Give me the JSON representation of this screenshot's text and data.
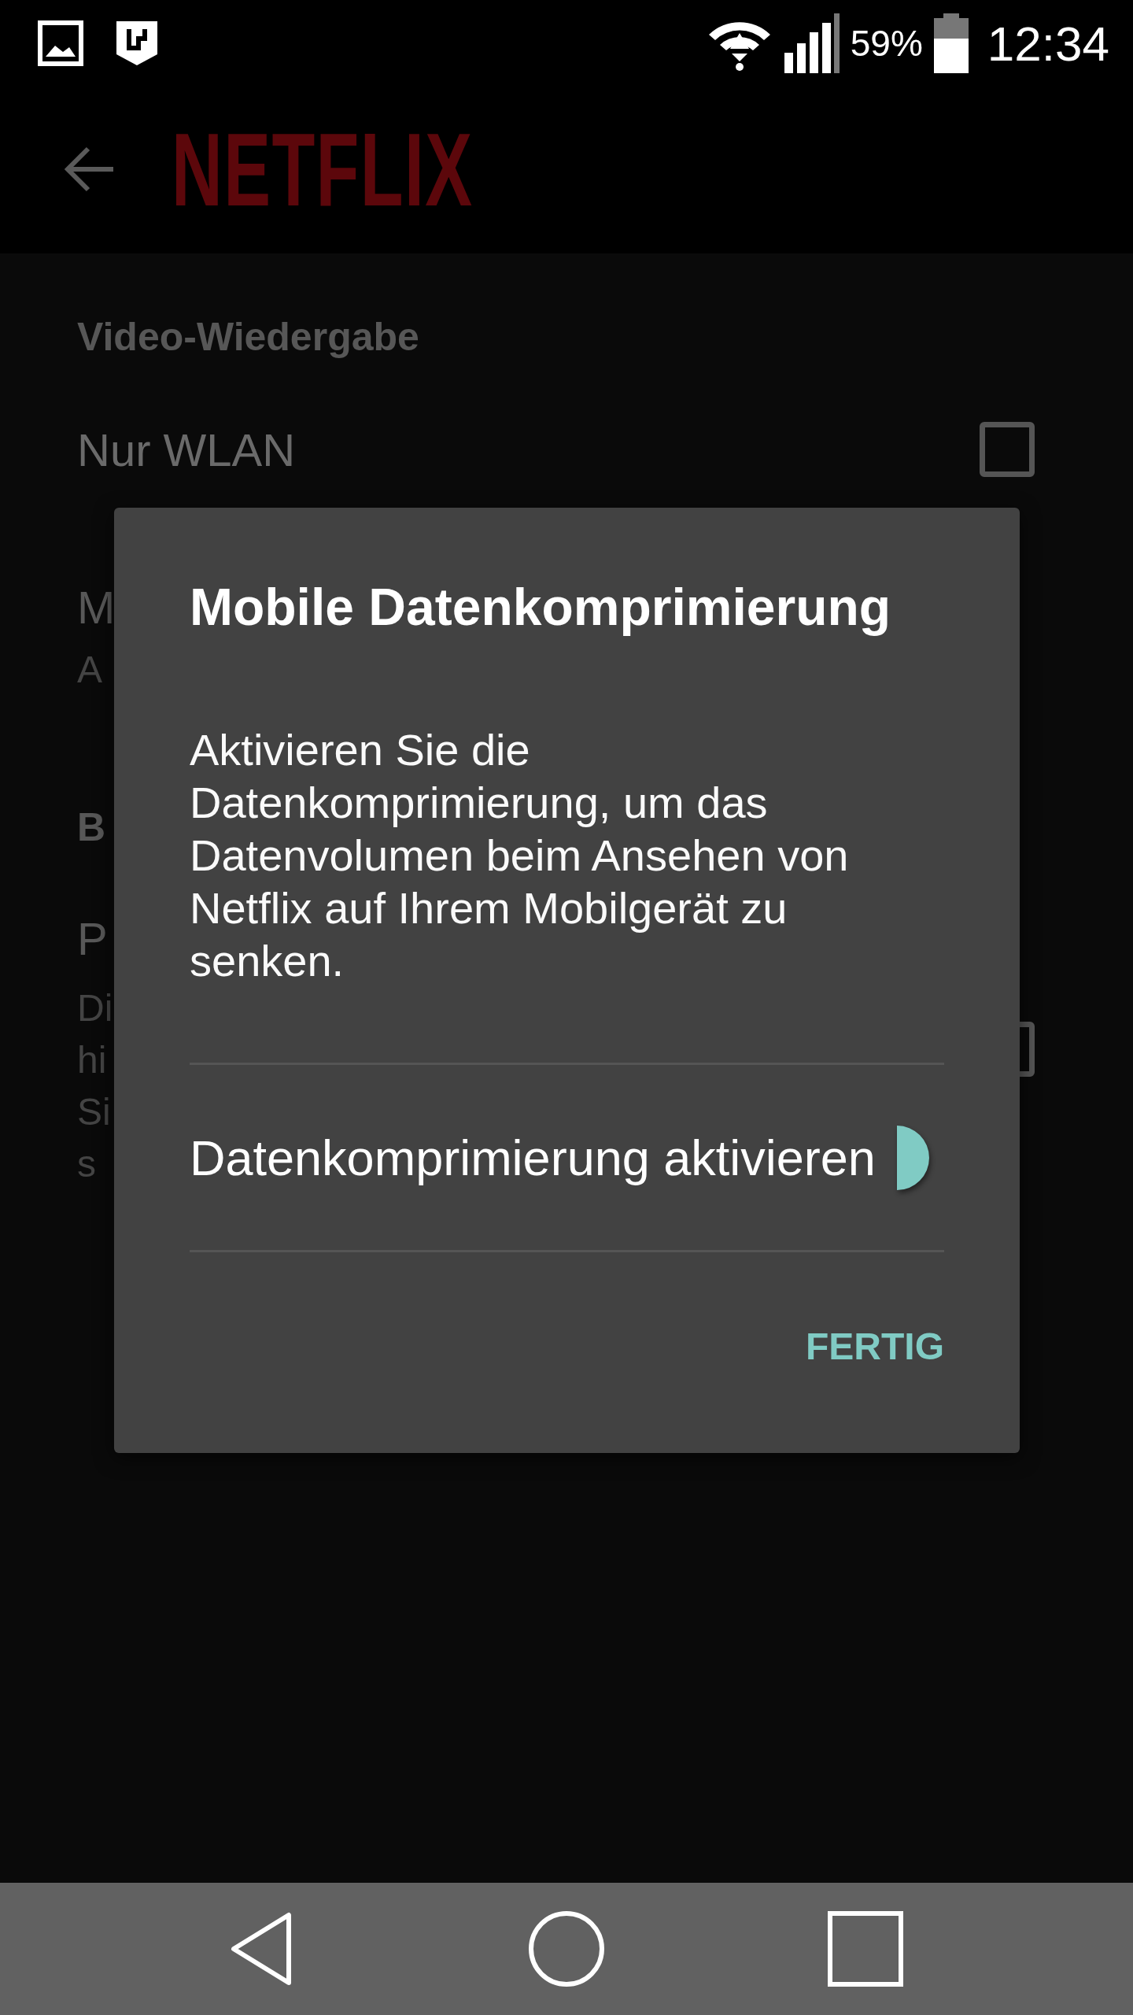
{
  "status_bar": {
    "battery": "59%",
    "time": "12:34"
  },
  "app_bar": {
    "logo": "NETFLIX"
  },
  "settings": [
    {
      "kind": "header",
      "text": "Video-Wiedergabe"
    },
    {
      "kind": "checkbox",
      "label": "Nur WLAN",
      "checked": false
    },
    {
      "kind": "item",
      "title": "M",
      "lines": [
        "A"
      ]
    },
    {
      "kind": "header",
      "text": "B"
    },
    {
      "kind": "checkbox_item",
      "title": "P",
      "lines": [
        "Di",
        "hi",
        "Si",
        "s"
      ],
      "checked": false
    }
  ],
  "dialog": {
    "title": "Mobile Datenkomprimierung",
    "message": "Aktivieren Sie die Datenkomprimierung, um das Datenvolumen beim Ansehen von Netflix auf Ihrem Mobilgerät zu senken.",
    "switch": {
      "label": "Datenkomprimierung aktivieren",
      "on": true
    },
    "button": "FERTIG"
  }
}
